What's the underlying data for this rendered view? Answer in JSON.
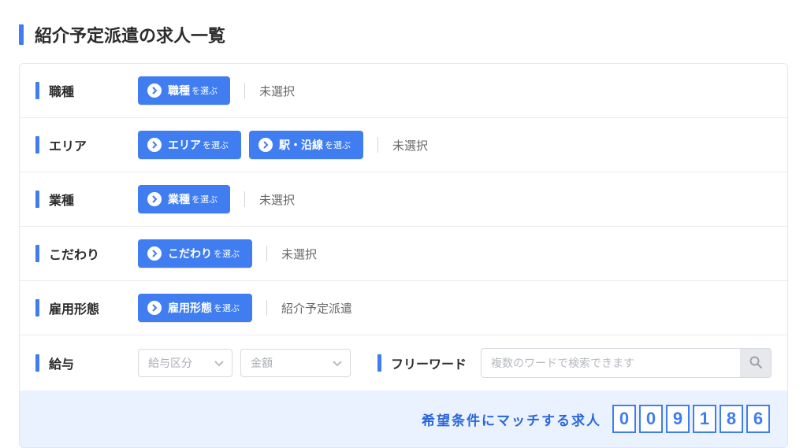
{
  "pageTitle": "紹介予定派遣の求人一覧",
  "rows": {
    "jobType": {
      "label": "職種",
      "button": "職種",
      "suffix": "を選ぶ",
      "value": "未選択"
    },
    "area": {
      "label": "エリア",
      "button1": "エリア",
      "suffix1": "を選ぶ",
      "button2": "駅・沿線",
      "suffix2": "を選ぶ",
      "value": "未選択"
    },
    "industry": {
      "label": "業種",
      "button": "業種",
      "suffix": "を選ぶ",
      "value": "未選択"
    },
    "feature": {
      "label": "こだわり",
      "button": "こだわり",
      "suffix": "を選ぶ",
      "value": "未選択"
    },
    "employment": {
      "label": "雇用形態",
      "button": "雇用形態",
      "suffix": "を選ぶ",
      "value": "紹介予定派遣"
    },
    "salary": {
      "label": "給与",
      "dd1": "給与区分",
      "dd2": "金額"
    },
    "freeword": {
      "label": "フリーワード",
      "placeholder": "複数のワードで検索できます"
    }
  },
  "footer": {
    "label": "希望条件にマッチする求人",
    "digits": [
      "0",
      "0",
      "9",
      "1",
      "8",
      "6"
    ]
  }
}
